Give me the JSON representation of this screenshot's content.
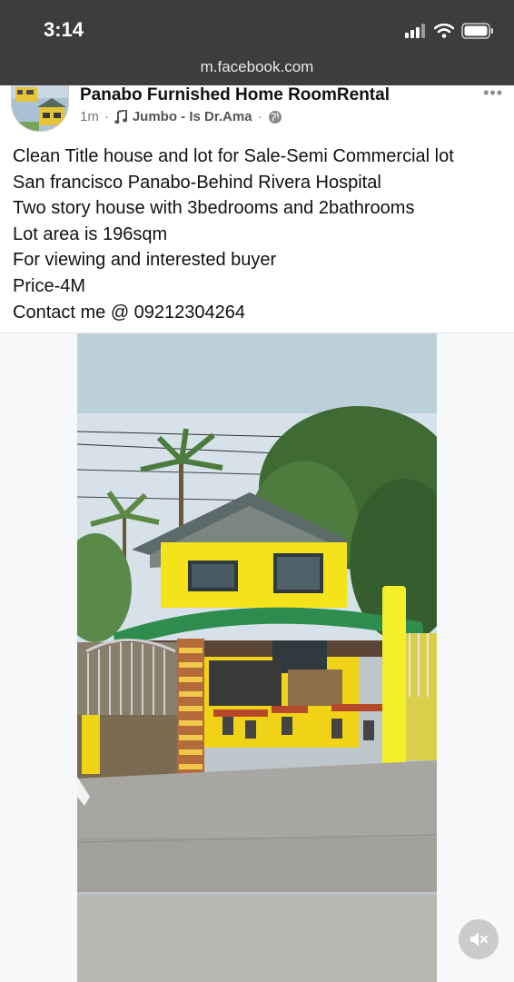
{
  "status_bar": {
    "time": "3:14",
    "url": "m.facebook.com"
  },
  "post": {
    "page_name": "Panabo Furnished Home RoomRental",
    "age": "1m",
    "separator": "·",
    "music_icon": "music-note-icon",
    "song": "Jumbo - Is Dr.Ama",
    "privacy_icon": "globe-icon",
    "more_icon": "more-dots-icon",
    "more_label": "•••",
    "text_lines": [
      "Clean Title house and lot for Sale-Semi Commercial lot",
      "San francisco Panabo-Behind Rivera Hospital",
      "Two story house with 3bedrooms and 2bathrooms",
      "Lot area is 196sqm",
      "For viewing and interested buyer",
      "Price-4M",
      "Contact me @ 09212304264"
    ]
  },
  "media": {
    "type": "video",
    "mute_icon": "muted-speaker-icon"
  },
  "colors": {
    "status_bar_bg": "#3d3d3d",
    "house_yellow": "#f4e21a",
    "roof_green": "#2e8c4e",
    "highlight_yellow": "#f5ef2a"
  }
}
